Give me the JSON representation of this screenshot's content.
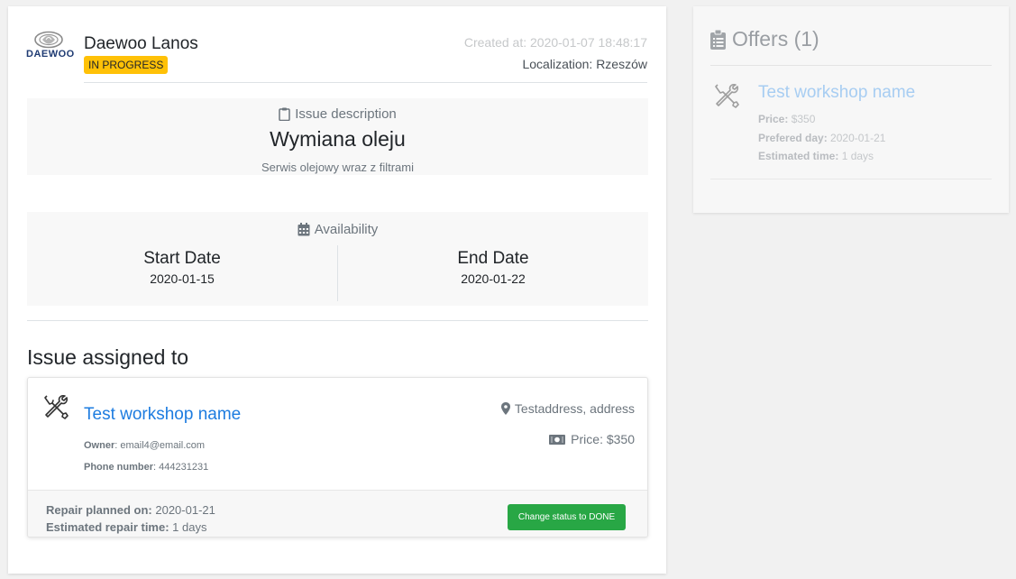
{
  "vehicle": {
    "brand_logo_text": "DAEWOO",
    "name": "Daewoo Lanos",
    "status": "IN PROGRESS",
    "status_color": "#ffc107"
  },
  "meta": {
    "created_at": "Created at: 2020-01-07 18:48:17",
    "localization": "Localization: Rzeszów"
  },
  "issue": {
    "heading": "Issue description",
    "title": "Wymiana oleju",
    "description": "Serwis olejowy wraz z filtrami"
  },
  "availability": {
    "heading": "Availability",
    "start_label": "Start Date",
    "start_value": "2020-01-15",
    "end_label": "End Date",
    "end_value": "2020-01-22"
  },
  "assigned": {
    "heading": "Issue assigned to",
    "workshop_name": "Test workshop name",
    "owner_label": "Owner",
    "owner_value": "email4@email.com",
    "phone_label": "Phone number",
    "phone_value": "444231231",
    "address": "Testaddress, address",
    "price": "Price: $350",
    "planned_label": "Repair planned on:",
    "planned_value": "2020-01-21",
    "est_label": "Estimated repair time:",
    "est_value": "1 days",
    "action_button": "Change status to DONE",
    "action_color": "#28a745"
  },
  "offers": {
    "heading": "Offers (1)",
    "items": [
      {
        "workshop_name": "Test workshop name",
        "price_label": "Price:",
        "price_value": "$350",
        "day_label": "Prefered day:",
        "day_value": "2020-01-21",
        "time_label": "Estimated time:",
        "time_value": "1 days"
      }
    ]
  },
  "icons": [
    "daewoo-logo",
    "clipboard-icon",
    "calendar-icon",
    "tools-icon",
    "map-marker-icon",
    "money-bill-icon",
    "clipboard-list-icon"
  ],
  "colors": {
    "link": "#1d7ce0",
    "badge": "#ffc107",
    "button": "#28a745"
  }
}
